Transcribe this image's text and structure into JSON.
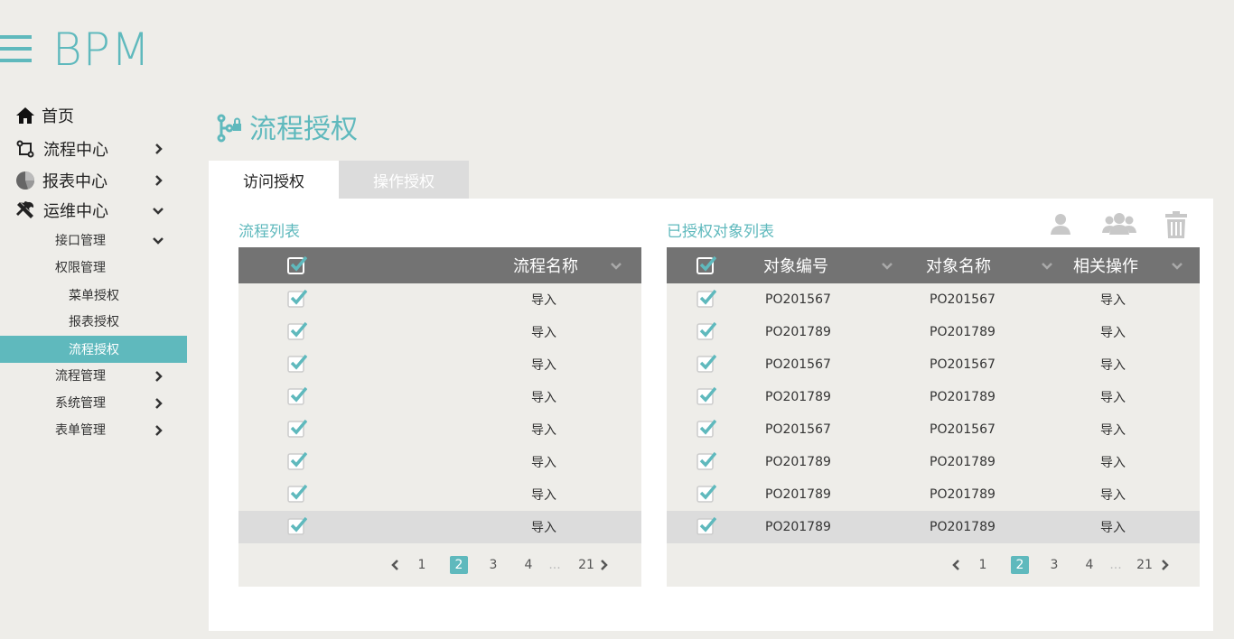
{
  "app": {
    "logo": "BPM"
  },
  "sidebar": {
    "items": [
      {
        "label": "首页",
        "icon": "home-icon"
      },
      {
        "label": "流程中心",
        "icon": "process-icon"
      },
      {
        "label": "报表中心",
        "icon": "pie-chart-icon"
      },
      {
        "label": "运维中心",
        "icon": "tools-icon"
      },
      {
        "label": "接口管理"
      },
      {
        "label": "权限管理"
      },
      {
        "label": "菜单授权"
      },
      {
        "label": "报表授权"
      },
      {
        "label": "流程授权"
      },
      {
        "label": "流程管理"
      },
      {
        "label": "系统管理"
      },
      {
        "label": "表单管理"
      }
    ],
    "active": "流程授权"
  },
  "page": {
    "title": "流程授权"
  },
  "tabs": [
    {
      "label": "访问授权",
      "active": true
    },
    {
      "label": "操作授权",
      "active": false
    }
  ],
  "left_table": {
    "title": "流程列表",
    "columns": [
      "流程名称"
    ],
    "rows": [
      {
        "checked": true,
        "action": "导入"
      },
      {
        "checked": true,
        "action": "导入"
      },
      {
        "checked": true,
        "action": "导入"
      },
      {
        "checked": true,
        "action": "导入"
      },
      {
        "checked": true,
        "action": "导入"
      },
      {
        "checked": true,
        "action": "导入"
      },
      {
        "checked": true,
        "action": "导入"
      },
      {
        "checked": true,
        "action": "导入",
        "highlighted": true
      }
    ],
    "pagination": {
      "pages": [
        "1",
        "2",
        "3",
        "4",
        "...",
        "21"
      ],
      "current": "2"
    }
  },
  "right_table": {
    "title": "已授权对象列表",
    "columns": [
      "对象编号",
      "对象名称",
      "相关操作"
    ],
    "rows": [
      {
        "checked": true,
        "code": "PO201567",
        "name": "PO201567",
        "action": "导入"
      },
      {
        "checked": true,
        "code": "PO201789",
        "name": "PO201789",
        "action": "导入"
      },
      {
        "checked": true,
        "code": "PO201567",
        "name": "PO201567",
        "action": "导入"
      },
      {
        "checked": true,
        "code": "PO201789",
        "name": "PO201789",
        "action": "导入"
      },
      {
        "checked": true,
        "code": "PO201567",
        "name": "PO201567",
        "action": "导入"
      },
      {
        "checked": true,
        "code": "PO201789",
        "name": "PO201789",
        "action": "导入"
      },
      {
        "checked": true,
        "code": "PO201789",
        "name": "PO201789",
        "action": "导入"
      },
      {
        "checked": true,
        "code": "PO201789",
        "name": "PO201789",
        "action": "导入",
        "highlighted": true
      }
    ],
    "pagination": {
      "pages": [
        "1",
        "2",
        "3",
        "4",
        "...",
        "21"
      ],
      "current": "2"
    },
    "toolbar_icons": [
      "user-icon",
      "group-icon",
      "trash-icon"
    ]
  },
  "colors": {
    "accent": "#5fb9bd",
    "header_bg": "#737373",
    "page_bg": "#eeede9",
    "row_highlight": "#dcdcdc"
  }
}
